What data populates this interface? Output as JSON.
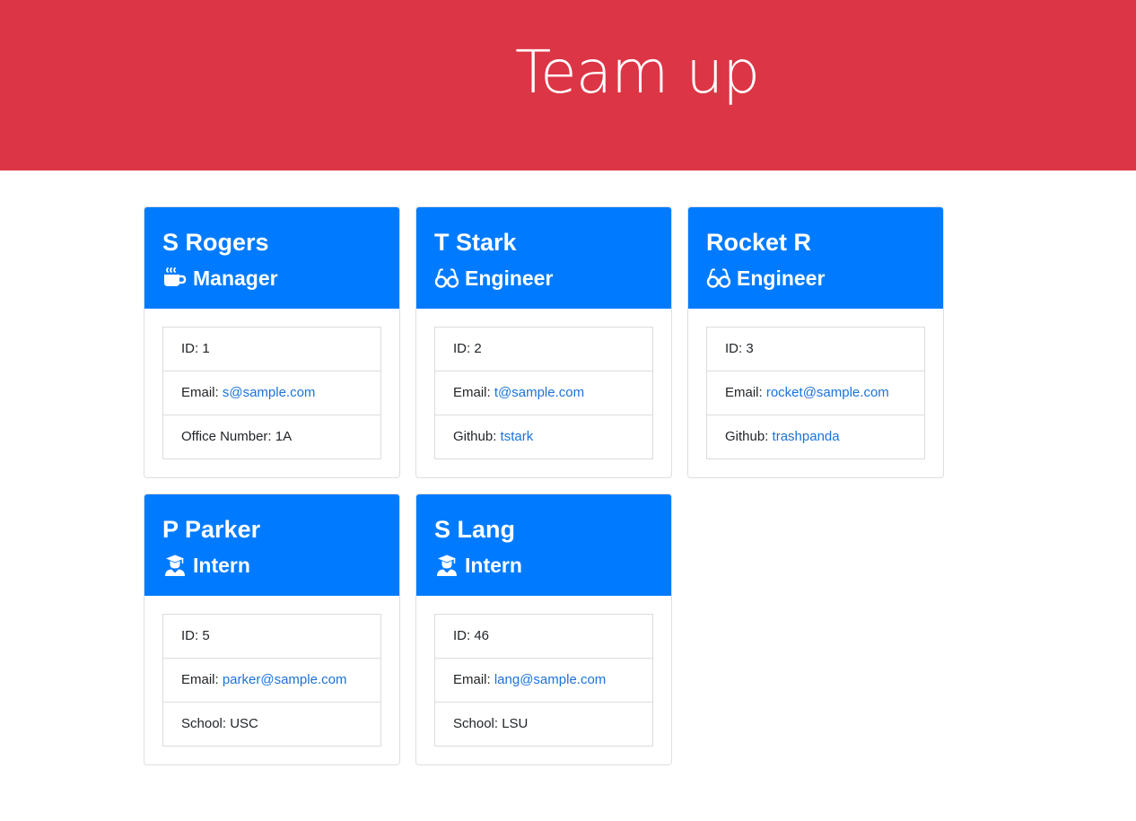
{
  "header": {
    "title": "Team up",
    "background_color": "#dc3545"
  },
  "accent_color": "#007bff",
  "link_color": "#1a73d9",
  "cards": [
    {
      "name": "S Rogers",
      "role": "Manager",
      "role_icon": "coffee-icon",
      "id_label": "ID: ",
      "id": "1",
      "email_label": "Email: ",
      "email": "s@sample.com",
      "extra_label": "Office Number: ",
      "extra_value": "1A"
    },
    {
      "name": "T Stark",
      "role": "Engineer",
      "role_icon": "glasses-icon",
      "id_label": "ID: ",
      "id": "2",
      "email_label": "Email: ",
      "email": "t@sample.com",
      "extra_label": "Github: ",
      "extra_value": "tstark"
    },
    {
      "name": "Rocket R",
      "role": "Engineer",
      "role_icon": "glasses-icon",
      "id_label": "ID: ",
      "id": "3",
      "email_label": "Email: ",
      "email": "rocket@sample.com",
      "extra_label": "Github: ",
      "extra_value": "trashpanda"
    },
    {
      "name": "P Parker",
      "role": "Intern",
      "role_icon": "graduate-icon",
      "id_label": "ID: ",
      "id": "5",
      "email_label": "Email: ",
      "email": "parker@sample.com",
      "extra_label": "School: ",
      "extra_value": "USC"
    },
    {
      "name": "S Lang",
      "role": "Intern",
      "role_icon": "graduate-icon",
      "id_label": "ID: ",
      "id": "46",
      "email_label": "Email: ",
      "email": "lang@sample.com",
      "extra_label": "School: ",
      "extra_value": "LSU"
    }
  ]
}
